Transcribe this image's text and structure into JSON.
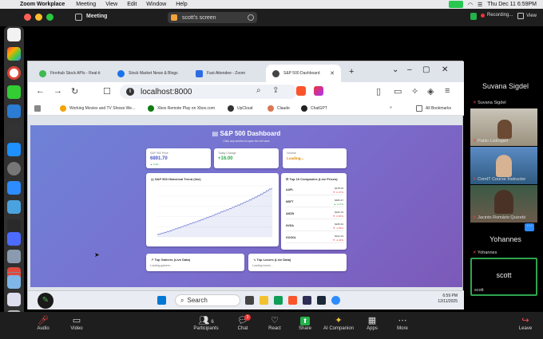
{
  "menubar": {
    "app": "Zoom Workplace",
    "items": [
      "Meeting",
      "View",
      "Edit",
      "Window",
      "Help"
    ],
    "datetime": "Thu Dec 11  6:59PM"
  },
  "zoom_top": {
    "title": "Meeting",
    "share_label": "scott's screen",
    "recording": "Recording...",
    "view": "View"
  },
  "browser": {
    "tabs": [
      {
        "label": "Finnhub Stock APIs - Real-ti",
        "active": false
      },
      {
        "label": "Stock Market News & Blogs",
        "active": false
      },
      {
        "label": "Fast Attendee - Zoom",
        "active": false
      },
      {
        "label": "S&P 500 Dashboard",
        "active": true
      }
    ],
    "url": "localhost:8000",
    "bookmarks": [
      "Working Movies and TV Shows We...",
      "Xbox Remote Play on Xbox.com",
      "UpCloud",
      "Claude",
      "ChatGPT"
    ],
    "all_bookmarks": "All Bookmarks"
  },
  "dashboard": {
    "title": "S&P 500 Dashboard",
    "subtitle": "Click any section to open the full view",
    "cards": [
      {
        "label": "S&P 500 Price",
        "value": "6891.70",
        "change": "▲ 0.2%"
      },
      {
        "label": "Today Change",
        "value": "+16.00",
        "change": ""
      },
      {
        "label": "Volume",
        "value": "Loading...",
        "change": ""
      }
    ],
    "trend_title": "S&P 500 Historical Trend (live)",
    "top10_title": "Top 10 Companies (Live Prices)",
    "top10": [
      {
        "sym": "AAPL",
        "price": "$278.03",
        "pct": "▼ -0.27%"
      },
      {
        "sym": "MSFT",
        "price": "$483.47",
        "pct": "▲ 1.17%"
      },
      {
        "sym": "AMZN",
        "price": "$226.19",
        "pct": "▼ -0.65%"
      },
      {
        "sym": "NVDA",
        "price": "$180.93",
        "pct": "▼ -1.55%"
      },
      {
        "sym": "GOOGL",
        "price": "$312.43",
        "pct": "▼ -2.43%"
      }
    ],
    "gainers_title": "Top Gainers (Live Data)",
    "losers_title": "Top Losers (Live Data)",
    "loading": "Loading gainers...",
    "loading2": "Loading losers..."
  },
  "chart_data": {
    "type": "line",
    "title": "S&P 500 Historical Trend (live)",
    "series": [
      {
        "values": [
          4700,
          4740,
          4720,
          4780,
          4760,
          4820,
          4800,
          4860,
          4840,
          4900,
          4880,
          4950,
          4930,
          5000,
          4980,
          5040,
          5020,
          5090,
          5070,
          5140,
          5120,
          5180,
          5160,
          5230,
          5210,
          5280,
          5260,
          5320,
          5300,
          5370,
          5350,
          5420,
          5400,
          5470,
          5450,
          5520,
          5500,
          5570,
          5550,
          5620,
          5600,
          5680,
          5660,
          5730,
          5710,
          5790,
          5770,
          5840,
          5820,
          5890,
          5870,
          5940,
          5920,
          6000,
          5980,
          6060,
          6040,
          6110,
          6090,
          6170,
          6150,
          6230,
          6210,
          6290,
          6270,
          6350,
          6330,
          6420,
          6400,
          6480,
          6460,
          6550,
          6530,
          6620,
          6600,
          6700,
          6680,
          6780,
          6760,
          6860,
          6840,
          6891
        ]
      }
    ],
    "ylim": [
      4600,
      7000
    ],
    "grid": true,
    "color": "#7b86d6"
  },
  "taskbar": {
    "search": "Search",
    "time": "6:59 PM",
    "date": "12/11/2025"
  },
  "participants": [
    {
      "big": "Suvana Sigdel",
      "name": "Suvana Sigdel"
    },
    {
      "name": "Pablo Listingart"
    },
    {
      "name": "ComIT Course Instructor"
    },
    {
      "name": "Jacinto Romário Quizebi"
    },
    {
      "big": "Yohannes",
      "name": "Yohannes"
    },
    {
      "big": "scott",
      "name": "scott"
    }
  ],
  "zoom_controls": [
    {
      "label": "Audio",
      "icon": "🎤"
    },
    {
      "label": "Video",
      "icon": "▭"
    },
    {
      "label": "Participants",
      "icon": "👥",
      "count": "6"
    },
    {
      "label": "Chat",
      "icon": "💬",
      "badge": "3"
    },
    {
      "label": "React",
      "icon": "♡"
    },
    {
      "label": "Share",
      "icon": "⬆"
    },
    {
      "label": "AI Companion",
      "icon": "✦"
    },
    {
      "label": "Apps",
      "icon": "▦"
    },
    {
      "label": "More",
      "icon": "⋯"
    },
    {
      "label": "Leave",
      "icon": "↪"
    }
  ]
}
